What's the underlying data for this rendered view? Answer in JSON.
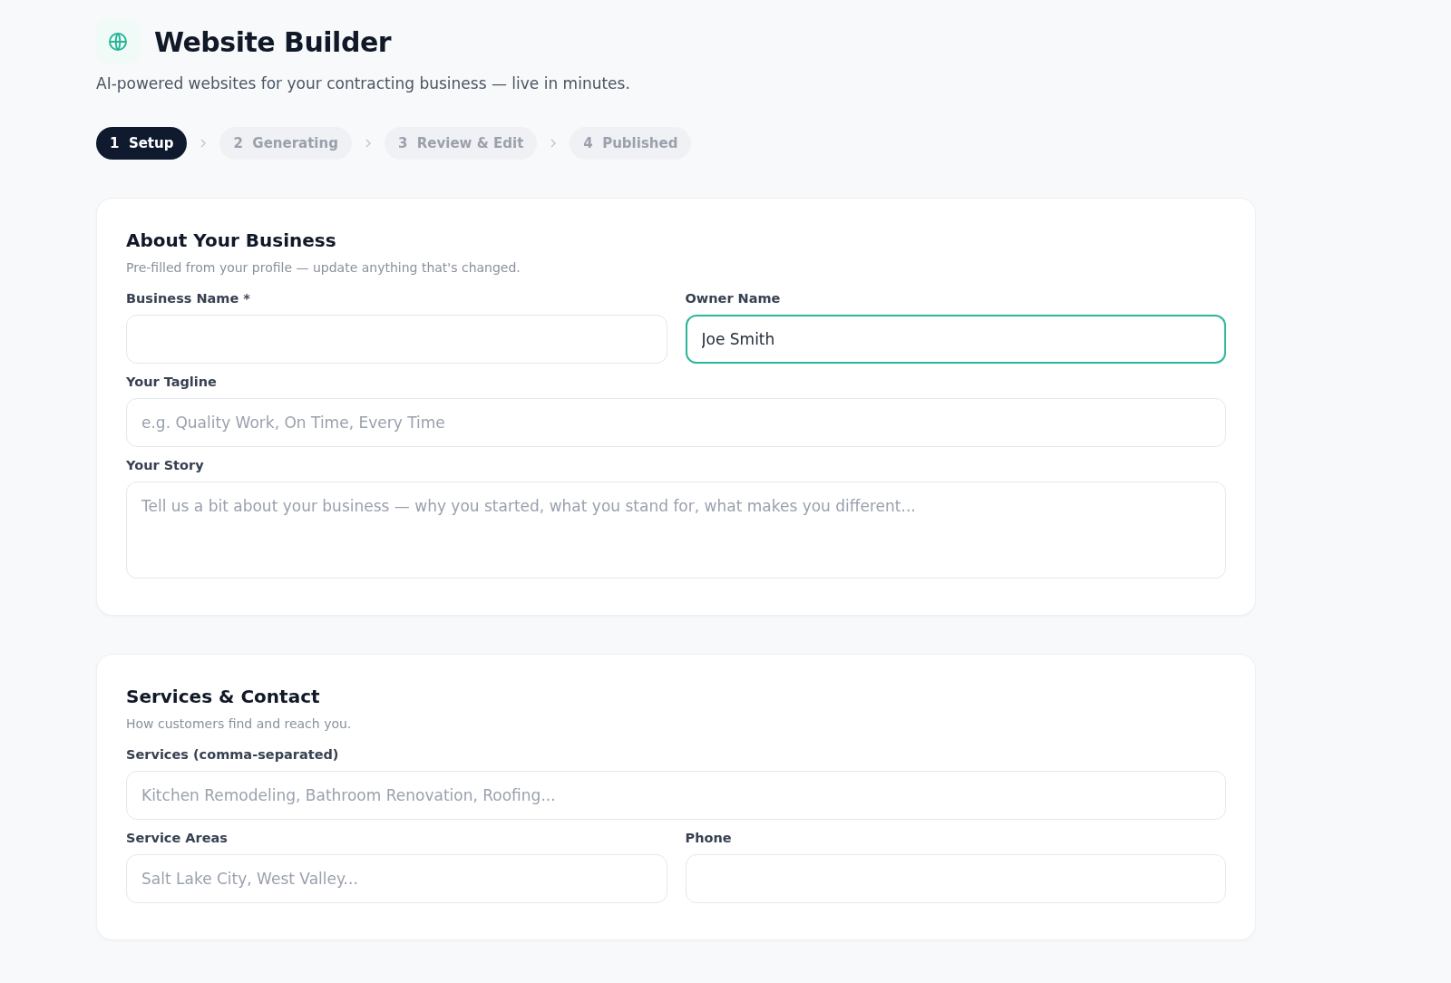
{
  "header": {
    "title": "Website Builder",
    "subtitle": "AI-powered websites for your contracting business — live in minutes."
  },
  "steps": [
    {
      "number": "1",
      "label": "Setup",
      "selected": true
    },
    {
      "number": "2",
      "label": "Generating",
      "selected": false
    },
    {
      "number": "3",
      "label": "Review & Edit",
      "selected": false
    },
    {
      "number": "4",
      "label": "Published",
      "selected": false
    }
  ],
  "sections": [
    {
      "title": "About Your Business",
      "description": "Pre-filled from your profile — update anything that's changed.",
      "rows": [
        [
          {
            "label": "Business Name *",
            "kind": "input",
            "focused": false
          },
          {
            "label": "Owner Name",
            "kind": "input",
            "value": "Joe Smith",
            "focused": true
          }
        ],
        [
          {
            "label": "Your Tagline",
            "kind": "input",
            "placeholder": "e.g. Quality Work, On Time, Every Time",
            "focused": false
          }
        ],
        [
          {
            "label": "Your Story",
            "kind": "textarea",
            "placeholder": "Tell us a bit about your business — why you started, what you stand for, what makes you different...",
            "focused": false
          }
        ]
      ]
    },
    {
      "title": "Services & Contact",
      "description": "How customers find and reach you.",
      "rows": [
        [
          {
            "label": "Services (comma-separated)",
            "kind": "input",
            "placeholder": "Kitchen Remodeling, Bathroom Renovation, Roofing...",
            "focused": false
          }
        ],
        [
          {
            "label": "Service Areas",
            "kind": "input",
            "placeholder": "Salt Lake City, West Valley...",
            "focused": false
          },
          {
            "label": "Phone",
            "kind": "input",
            "focused": false
          }
        ]
      ]
    }
  ]
}
